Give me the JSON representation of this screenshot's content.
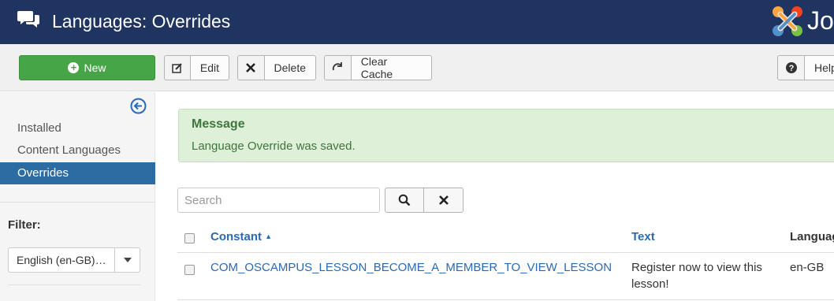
{
  "header": {
    "title": "Languages: Overrides",
    "title_icon": "comments-icon",
    "brand_text": "Jo",
    "brand_logo": "joomla-logo",
    "background": "#1f3461"
  },
  "toolbar": {
    "new_label": "New",
    "edit_label": "Edit",
    "delete_label": "Delete",
    "clear_cache_label": "Clear Cache",
    "help_label": "Help",
    "new_color": "#46a546"
  },
  "sidebar": {
    "items": [
      {
        "label": "Installed",
        "active": false
      },
      {
        "label": "Content Languages",
        "active": false
      },
      {
        "label": "Overrides",
        "active": true
      }
    ],
    "filter_label": "Filter:",
    "filter_value": "English (en-GB)…",
    "active_color": "#2d6ca2"
  },
  "message": {
    "heading": "Message",
    "text": "Language Override was saved.",
    "color": "#dff0d8"
  },
  "search": {
    "placeholder": "Search",
    "value": ""
  },
  "table": {
    "columns": [
      "Constant",
      "Text",
      "Language"
    ],
    "sort_indicator": "▲",
    "rows": [
      {
        "constant": "COM_OSCAMPUS_LESSON_BECOME_A_MEMBER_TO_VIEW_LESSON",
        "text": "Register now to view this lesson!",
        "language": "en-GB"
      }
    ]
  }
}
